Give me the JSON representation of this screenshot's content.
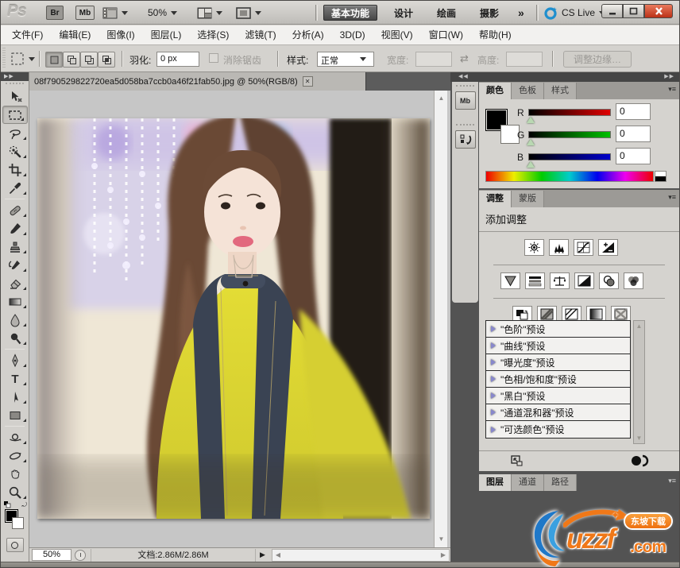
{
  "titlebar": {
    "logo": "Ps",
    "bridge_btn": "Br",
    "minibridge_btn": "Mb",
    "zoom_level": "50%",
    "workspaces": [
      {
        "label": "基本功能",
        "active": true
      },
      {
        "label": "设计",
        "active": false
      },
      {
        "label": "绘画",
        "active": false
      },
      {
        "label": "摄影",
        "active": false
      }
    ],
    "overflow": "»",
    "cslive_label": "CS Live"
  },
  "menubar": {
    "items": [
      "文件(F)",
      "编辑(E)",
      "图像(I)",
      "图层(L)",
      "选择(S)",
      "滤镜(T)",
      "分析(A)",
      "3D(D)",
      "视图(V)",
      "窗口(W)",
      "帮助(H)"
    ]
  },
  "options": {
    "feather_label": "羽化:",
    "feather_value": "0 px",
    "antialias_label": "消除锯齿",
    "style_label": "样式:",
    "style_value": "正常",
    "width_label": "宽度:",
    "height_label": "高度:",
    "refine_edge_label": "调整边缘…"
  },
  "document": {
    "tab_title": "08f790529822720ea5d058ba7ccb0a46f21fab50.jpg @ 50%(RGB/8)",
    "status_zoom": "50%",
    "status_doc": "文档:2.86M/2.86M"
  },
  "panels": {
    "color": {
      "tabs": [
        "颜色",
        "色板",
        "样式"
      ],
      "channels": [
        {
          "label": "R",
          "value": "0"
        },
        {
          "label": "G",
          "value": "0"
        },
        {
          "label": "B",
          "value": "0"
        }
      ]
    },
    "adjust": {
      "tabs": [
        "调整",
        "蒙版"
      ],
      "title": "添加调整",
      "adjustment_icons": [
        "brightness-contrast",
        "levels",
        "curves",
        "exposure",
        "vibrance",
        "hue-saturation",
        "color-balance",
        "black-white",
        "photo-filter",
        "channel-mixer",
        "invert",
        "posterize",
        "threshold",
        "gradient-map",
        "selective-color"
      ],
      "presets": [
        "\"色阶\"预设",
        "\"曲线\"预设",
        "\"曝光度\"预设",
        "\"色相/饱和度\"预设",
        "\"黑白\"预设",
        "\"通道混和器\"预设",
        "\"可选颜色\"预设"
      ]
    },
    "layers": {
      "tabs": [
        "图层",
        "通道",
        "路径"
      ]
    }
  },
  "tools": [
    "move",
    "rectangular-marquee",
    "lasso",
    "quick-selection",
    "crop",
    "eyedropper",
    "spot-healing-brush",
    "brush",
    "clone-stamp",
    "history-brush",
    "eraser",
    "gradient",
    "blur",
    "dodge",
    "pen",
    "type",
    "path-selection",
    "rectangle-shape",
    "3d-rotate",
    "3d-orbit",
    "hand",
    "zoom"
  ],
  "watermark": {
    "name": "uzzf",
    "tld": ".com",
    "badge": "东坡下载"
  },
  "colors": {
    "dock_bg": "#535353",
    "panel_bg": "#d5d3cf",
    "canvas_bg": "#c6c6c6",
    "close_red": "#bb3117",
    "cslive_blue": "#1f8fce",
    "watermark_orange": "#f07818",
    "watermark_blue": "#1f78c8"
  }
}
